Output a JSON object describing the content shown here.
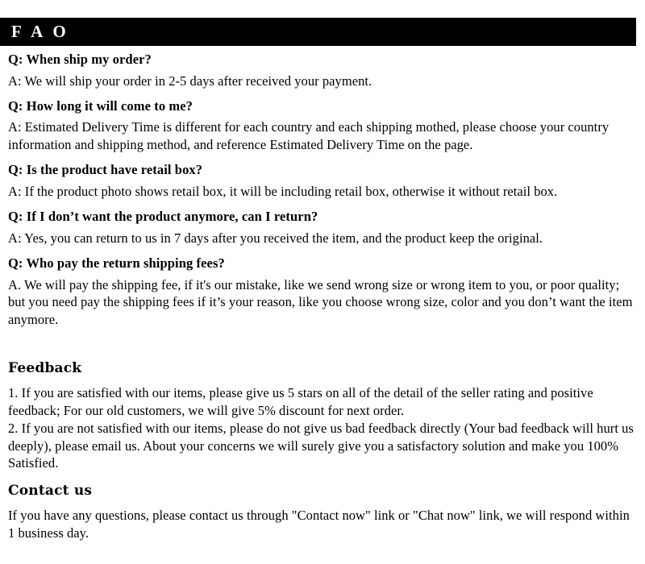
{
  "banner": {
    "title": "F A O"
  },
  "faq": {
    "items": [
      {
        "question": "Q: When ship my order?",
        "answer": "A: We will ship your order in 2-5 days after received your payment."
      },
      {
        "question": "Q: How long it will come to me?",
        "answer": "A: Estimated Delivery Time is different for each country and each shipping mothed, please choose your country information and shipping method, and reference Estimated Delivery Time on the page."
      },
      {
        "question": "Q: Is the product have retail box?",
        "answer": "A: If  the product photo shows retail box, it will be including retail box, otherwise it without retail box."
      },
      {
        "question": "Q: If I don’t want the product anymore, can I return?",
        "answer": "A: Yes, you can return to us in 7 days after you received the item, and the product keep the original."
      },
      {
        "question": "Q: Who pay the return shipping fees?",
        "answer": "A. We will pay the shipping fee, if  it's our mistake, like we send wrong size or wrong item to you, or poor quality; but you need pay the shipping fees if  it’s your reason, like you choose wrong size, color and you don’t want the item anymore."
      }
    ]
  },
  "feedback": {
    "heading": "Feedback",
    "paragraphs": [
      "1.  If you are satisfied with our items, please give us 5 stars on all of the detail of the seller rating and positive feedback; For our old customers, we will give 5% discount for next order.",
      "2.  If you are not satisfied with our items, please do not give us bad feedback directly (Your bad feedback will hurt us deeply), please email us. About your concerns we will surely give you a satisfactory solution and make you 100% Satisfied."
    ]
  },
  "contact": {
    "heading": "Contact us",
    "paragraph": "If you have any questions, please contact us through \"Contact now\" link or \"Chat now\" link, we will respond within 1 business day."
  },
  "colors": {
    "banner_background": "#000000",
    "banner_text": "#ffffff",
    "page_background": "#ffffff",
    "body_text": "#000000"
  }
}
